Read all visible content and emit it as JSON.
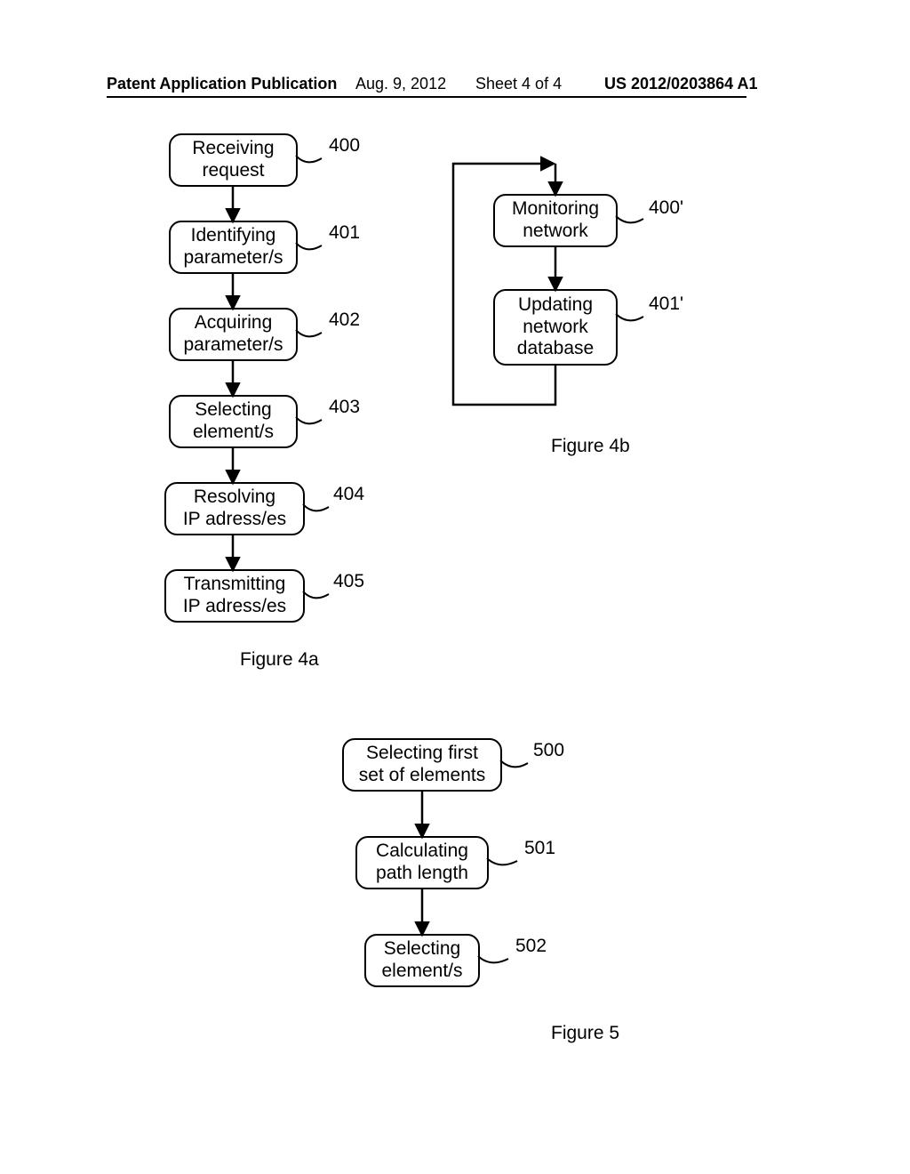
{
  "header": {
    "pub": "Patent Application Publication",
    "date": "Aug. 9, 2012",
    "sheet": "Sheet 4 of 4",
    "docnum": "US 2012/0203864 A1"
  },
  "fig4a": {
    "b400": "Receiving\nrequest",
    "l400": "400",
    "b401": "Identifying\nparameter/s",
    "l401": "401",
    "b402": "Acquiring\nparameter/s",
    "l402": "402",
    "b403": "Selecting\nelement/s",
    "l403": "403",
    "b404": "Resolving\nIP adress/es",
    "l404": "404",
    "b405": "Transmitting\nIP adress/es",
    "l405": "405",
    "caption": "Figure 4a"
  },
  "fig4b": {
    "b400p": "Monitoring\nnetwork",
    "l400p": "400'",
    "b401p": "Updating\nnetwork\ndatabase",
    "l401p": "401'",
    "caption": "Figure 4b"
  },
  "fig5": {
    "b500": "Selecting first\nset of elements",
    "l500": "500",
    "b501": "Calculating\npath length",
    "l501": "501",
    "b502": "Selecting\nelement/s",
    "l502": "502",
    "caption": "Figure 5"
  }
}
